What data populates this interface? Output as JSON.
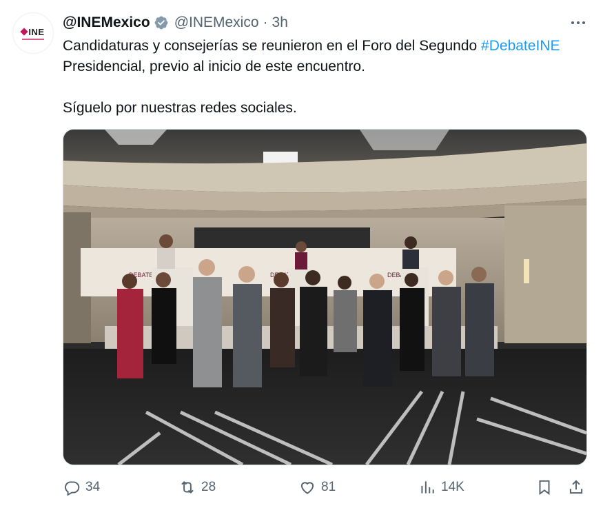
{
  "tweet": {
    "display_name": "@INEMexico",
    "handle": "@INEMexico",
    "separator": "·",
    "time": "3h",
    "avatar_label": "INE",
    "text_line1": "Candidaturas y consejerías se reunieron en el Foro del Segundo ",
    "hashtag": "#DebateINE",
    "text_line2": "Presidencial, previo al inicio de este encuentro.",
    "text_line3": "Síguelo por nuestras redes sociales."
  },
  "media": {
    "description_icon": "photo",
    "banner_logo": "DEBATE PRESIDENCIAL 2024"
  },
  "actions": {
    "replies": "34",
    "reposts": "28",
    "likes": "81",
    "views": "14K"
  },
  "colors": {
    "text": "#0f1419",
    "secondary": "#536471",
    "link": "#1d9bf0",
    "verified": "#829aab",
    "ine_magenta": "#c2185b"
  }
}
